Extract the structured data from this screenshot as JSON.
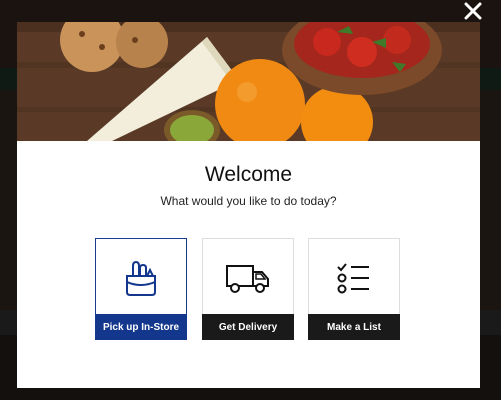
{
  "modal": {
    "close_glyph": "✕",
    "title": "Welcome",
    "subtitle": "What would you like to do today?",
    "options": [
      {
        "label": "Pick up In-Store",
        "icon": "grocery-bag-icon",
        "selected": true
      },
      {
        "label": "Get Delivery",
        "icon": "delivery-truck-icon",
        "selected": false
      },
      {
        "label": "Make a List",
        "icon": "checklist-icon",
        "selected": false
      }
    ]
  },
  "colors": {
    "selected_accent": "#12378c",
    "label_background": "#1a1a1a"
  }
}
